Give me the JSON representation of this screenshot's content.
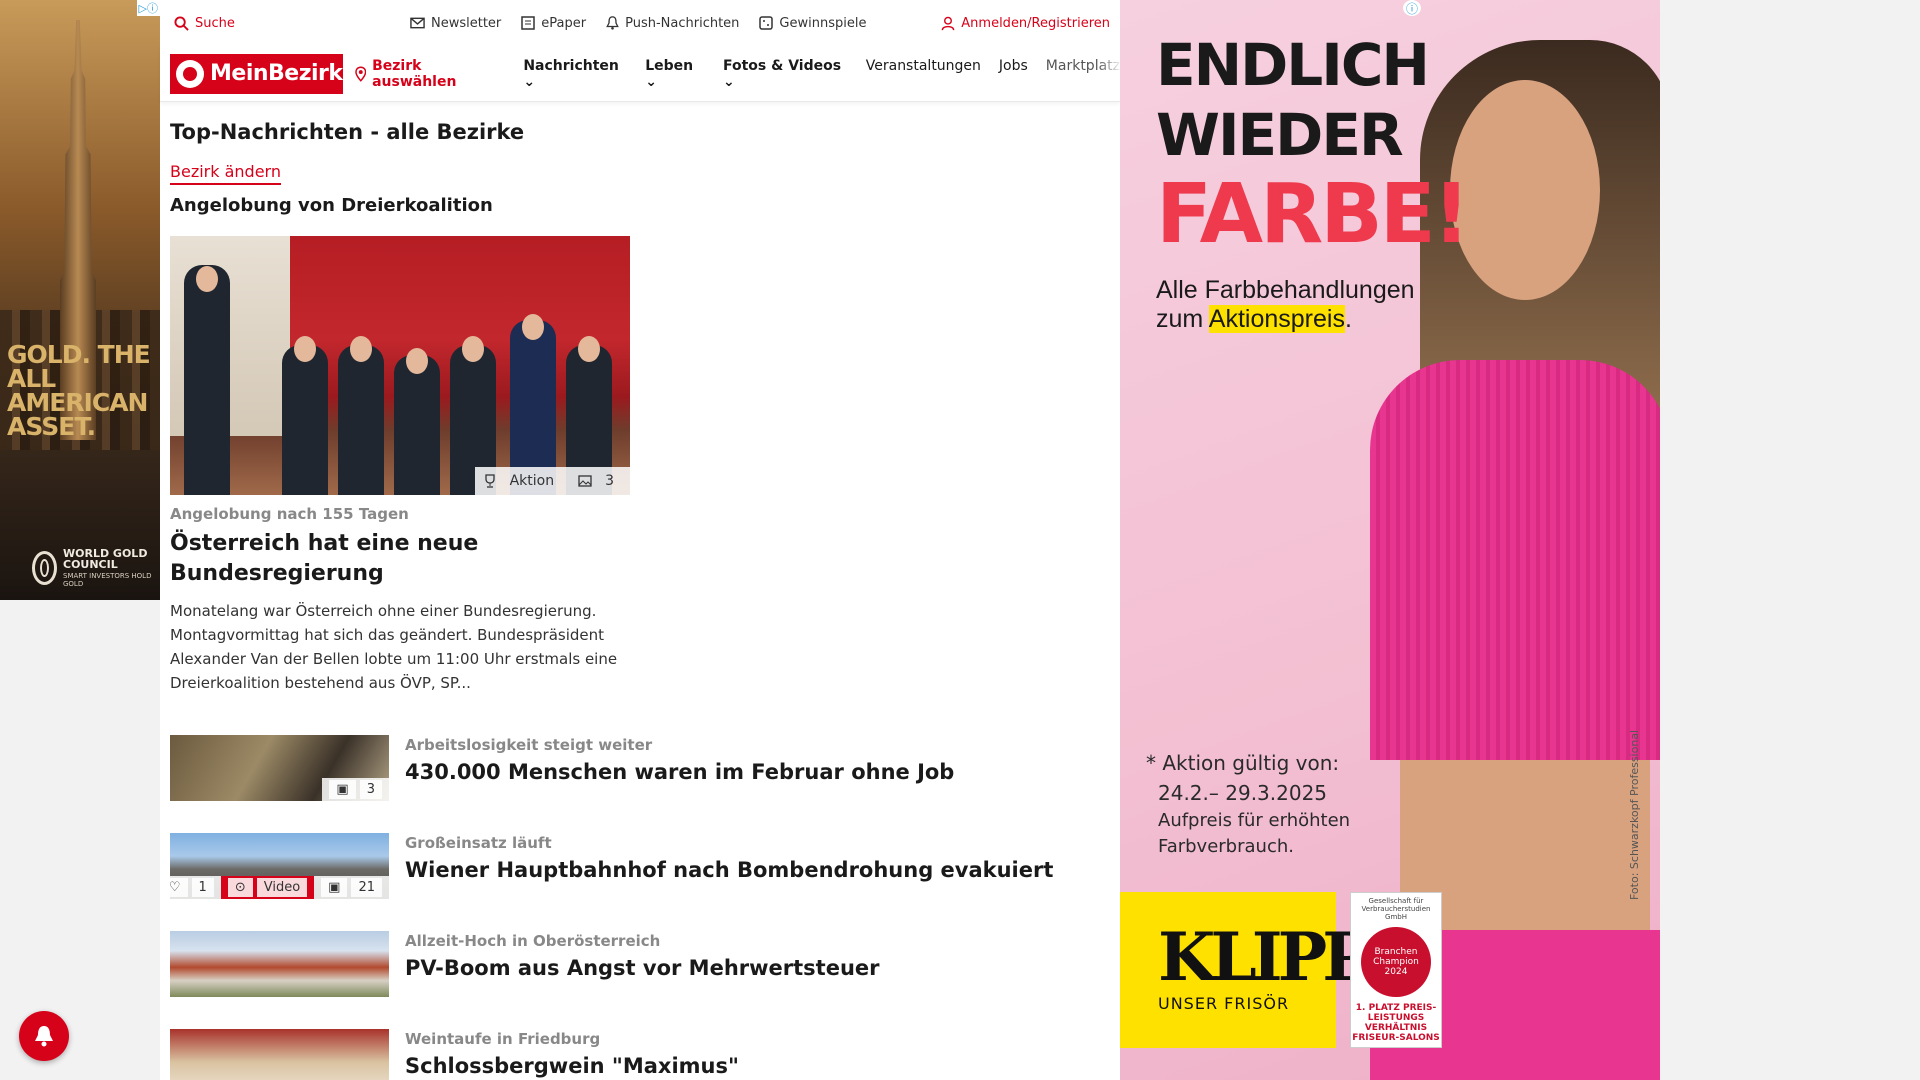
{
  "topbar": {
    "search_label": "Suche",
    "links": [
      "Newsletter",
      "ePaper",
      "Push-Nachrichten",
      "Gewinnspiele"
    ],
    "login_label": "Anmelden/Registrieren"
  },
  "navbar": {
    "logo_text": "MeinBezirk",
    "bezirk_label": "Bezirk auswählen",
    "items": [
      "Nachrichten",
      "Leben",
      "Fotos & Videos",
      "Veranstaltungen",
      "Jobs",
      "Marktplatz"
    ]
  },
  "section": {
    "title": "Top-Nachrichten - alle Bezirke",
    "change_label": "Bezirk ändern",
    "topic": "Angelobung von Dreierkoalition"
  },
  "hero": {
    "badge_label": "Aktion",
    "photo_count": "3",
    "kicker": "Angelobung nach 155 Tagen",
    "headline": "Österreich hat eine neue Bundesregierung",
    "teaser": "Monatelang war Österreich ohne einer Bundesregierung. Montagvormittag hat sich das geändert. Bundespräsident Alexander Van der Bellen lobte um 11:00 Uhr erstmals eine Dreierkoalition bestehend aus ÖVP, SP..."
  },
  "articles": [
    {
      "kicker": "Arbeitslosigkeit steigt weiter",
      "headline": "430.000 Menschen waren im Februar ohne Job",
      "photo_count": "3"
    },
    {
      "kicker": "Großeinsatz läuft",
      "headline": "Wiener Hauptbahnhof nach Bombendrohung evakuiert",
      "likes": "1",
      "video_label": "Video",
      "photo_count": "21"
    },
    {
      "kicker": "Allzeit-Hoch in Oberösterreich",
      "headline": "PV-Boom aus Angst vor Mehrwertsteuer"
    },
    {
      "kicker": "Weintaufe in Friedburg",
      "headline": "Schlossbergwein \"Maximus\""
    }
  ],
  "ad_left": {
    "slogan": "GOLD. THE ALL AMERICAN ASSET.",
    "org_name": "WORLD GOLD COUNCIL",
    "org_tag": "SMART INVESTORS HOLD GOLD"
  },
  "ad_right": {
    "headline_1": "ENDLICH WIEDER",
    "headline_2": "FARBE!",
    "sub_1": "Alle Farbbehandlungen",
    "sub_2a": "zum ",
    "sub_2b": "Aktionspreis",
    "sub_2c": ".",
    "note_1": "* Aktion gültig von:",
    "note_2": "24.2.– 29.3.2025",
    "note_3": "Aufpreis für erhöhten",
    "note_4": "Farbverbrauch.",
    "brand": "KLIPP",
    "brand_sub": "UNSER FRISÖR",
    "seal_top": "Gesellschaft für Verbraucherstudien GmbH",
    "seal_center": "Branchen Champion 2024",
    "seal_bottom": "1. PLATZ PREIS-LEISTUNGS VERHÄLTNIS FRISEUR-SALONS",
    "photo_credit": "Foto: Schwarzkopf Professional"
  },
  "colors": {
    "brand_red": "#d6021a",
    "ad_pink": "#f3bfd2",
    "ad_yellow": "#ffe100"
  }
}
